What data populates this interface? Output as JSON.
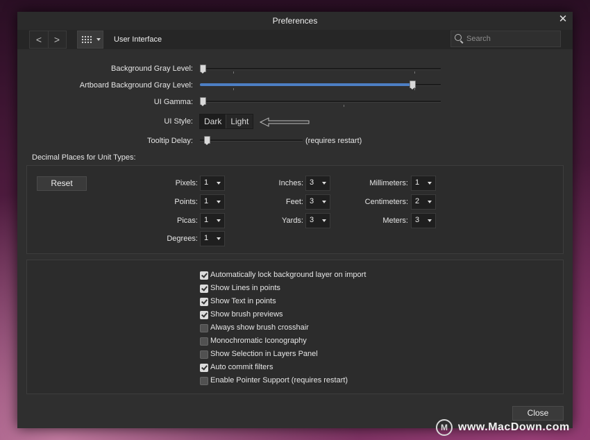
{
  "window": {
    "title": "Preferences",
    "close_glyph": "✕"
  },
  "toolbar": {
    "back_glyph": "<",
    "forward_glyph": ">",
    "section_title": "User Interface",
    "search_placeholder": "Search"
  },
  "ui": {
    "bg_gray_label": "Background Gray Level:",
    "bg_gray_value": 0.0,
    "artboard_gray_label": "Artboard Background Gray Level:",
    "artboard_gray_value": 0.89,
    "gamma_label": "UI Gamma:",
    "gamma_value": 0.0,
    "style_label": "UI Style:",
    "style_dark": "Dark",
    "style_light": "Light",
    "style_selected": "Dark",
    "tooltip_label": "Tooltip Delay:",
    "tooltip_value": 0.04,
    "tooltip_note": "(requires restart)"
  },
  "decimal": {
    "heading": "Decimal Places for Unit Types:",
    "reset_label": "Reset",
    "pixels_label": "Pixels:",
    "pixels_value": "1",
    "points_label": "Points:",
    "points_value": "1",
    "picas_label": "Picas:",
    "picas_value": "1",
    "degrees_label": "Degrees:",
    "degrees_value": "1",
    "inches_label": "Inches:",
    "inches_value": "3",
    "feet_label": "Feet:",
    "feet_value": "3",
    "yards_label": "Yards:",
    "yards_value": "3",
    "mm_label": "Millimeters:",
    "mm_value": "1",
    "cm_label": "Centimeters:",
    "cm_value": "2",
    "meters_label": "Meters:",
    "meters_value": "3"
  },
  "options": [
    {
      "label": "Automatically lock background layer on import",
      "checked": true
    },
    {
      "label": "Show Lines in points",
      "checked": true
    },
    {
      "label": "Show Text in points",
      "checked": true
    },
    {
      "label": "Show brush previews",
      "checked": true
    },
    {
      "label": "Always show brush crosshair",
      "checked": false
    },
    {
      "label": "Monochromatic Iconography",
      "checked": false
    },
    {
      "label": "Show Selection in Layers Panel",
      "checked": false
    },
    {
      "label": "Auto commit filters",
      "checked": true
    },
    {
      "label": "Enable Pointer Support (requires restart)",
      "checked": false
    }
  ],
  "footer": {
    "close_label": "Close"
  },
  "watermark": {
    "logo_text": "M",
    "text": "www.MacDown.com"
  },
  "colors": {
    "accent": "#4d7fc4",
    "window_bg": "#2f2f2f"
  }
}
